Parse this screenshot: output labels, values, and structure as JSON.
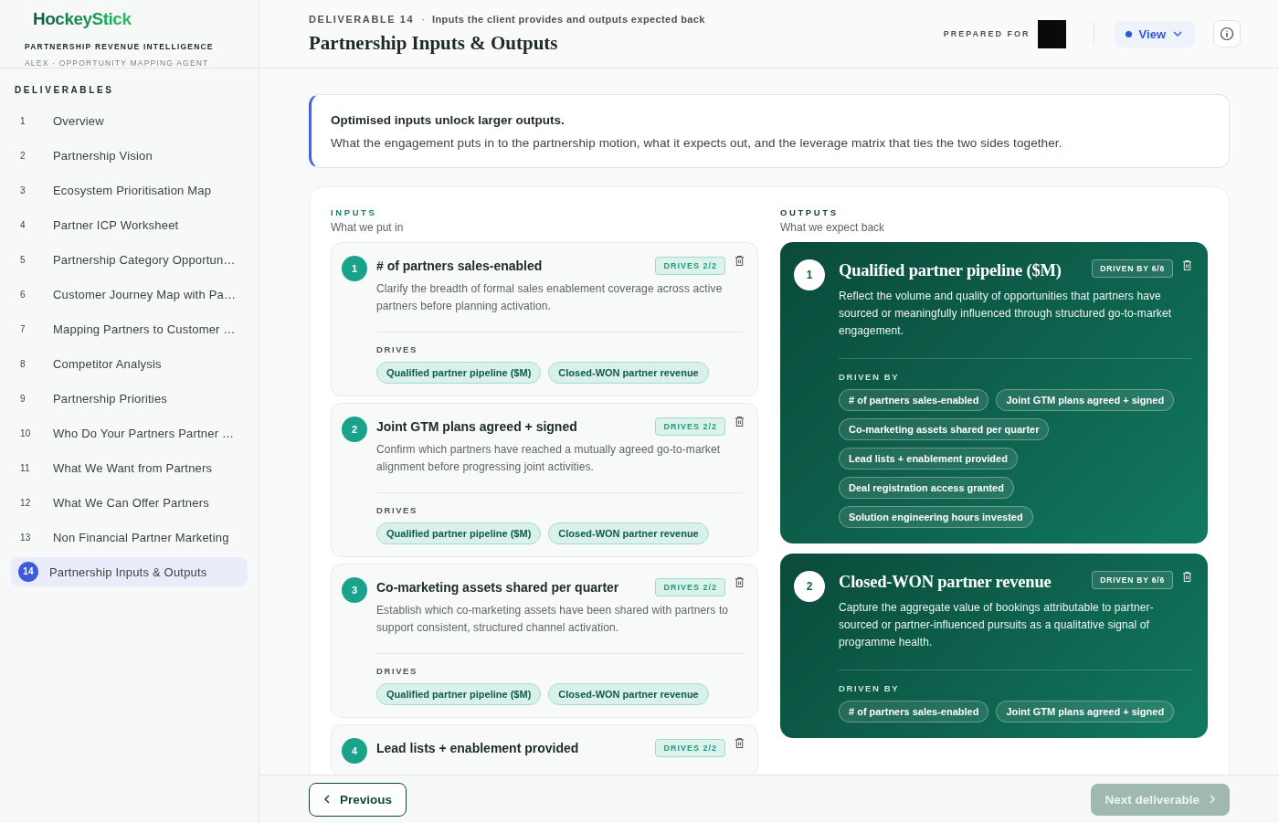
{
  "brand": {
    "logo": "HockeyStick",
    "product": "PARTNERSHIP REVENUE INTELLIGENCE",
    "agent": "ALEX · OPPORTUNITY MAPPING AGENT"
  },
  "sidebar": {
    "heading": "DELIVERABLES",
    "items": [
      {
        "number": "1",
        "label": "Overview",
        "selected": false
      },
      {
        "number": "2",
        "label": "Partnership Vision",
        "selected": false
      },
      {
        "number": "3",
        "label": "Ecosystem Prioritisation Map",
        "selected": false
      },
      {
        "number": "4",
        "label": "Partner ICP Worksheet",
        "selected": false
      },
      {
        "number": "5",
        "label": "Partnership Category Opportun…",
        "selected": false
      },
      {
        "number": "6",
        "label": "Customer Journey Map with Pa…",
        "selected": false
      },
      {
        "number": "7",
        "label": "Mapping Partners to Customer …",
        "selected": false
      },
      {
        "number": "8",
        "label": "Competitor Analysis",
        "selected": false
      },
      {
        "number": "9",
        "label": "Partnership Priorities",
        "selected": false
      },
      {
        "number": "10",
        "label": "Who Do Your Partners Partner …",
        "selected": false
      },
      {
        "number": "11",
        "label": "What We Want from Partners",
        "selected": false
      },
      {
        "number": "12",
        "label": "What We Can Offer Partners",
        "selected": false
      },
      {
        "number": "13",
        "label": "Non Financial Partner Marketing",
        "selected": false
      },
      {
        "number": "14",
        "label": "Partnership Inputs & Outputs",
        "selected": true
      }
    ]
  },
  "header": {
    "eyebrow": "DELIVERABLE 14",
    "separator": "·",
    "subtitle": "Inputs the client provides and outputs expected back",
    "title": "Partnership Inputs & Outputs",
    "prepared_for": "PREPARED FOR",
    "view_button": "View"
  },
  "callout": {
    "title": "Optimised inputs unlock larger outputs.",
    "text": "What the engagement puts in to the partnership motion, what it expects out, and the leverage matrix that ties the two sides together."
  },
  "inputs": {
    "heading": "INPUTS",
    "subheading": "What we put in",
    "cards": [
      {
        "number": "1",
        "title": "# of partners sales-enabled",
        "badge": "DRIVES 2/2",
        "description": "Clarify the breadth of formal sales enablement coverage across active partners before planning activation.",
        "links_label": "DRIVES",
        "links": [
          "Qualified partner pipeline ($M)",
          "Closed-WON partner revenue"
        ]
      },
      {
        "number": "2",
        "title": "Joint GTM plans agreed + signed",
        "badge": "DRIVES 2/2",
        "description": "Confirm which partners have reached a mutually agreed go-to-market alignment before progressing joint activities.",
        "links_label": "DRIVES",
        "links": [
          "Qualified partner pipeline ($M)",
          "Closed-WON partner revenue"
        ]
      },
      {
        "number": "3",
        "title": "Co-marketing assets shared per quarter",
        "badge": "DRIVES 2/2",
        "description": "Establish which co-marketing assets have been shared with partners to support consistent, structured channel activation.",
        "links_label": "DRIVES",
        "links": [
          "Qualified partner pipeline ($M)",
          "Closed-WON partner revenue"
        ]
      },
      {
        "number": "4",
        "title": "Lead lists + enablement provided",
        "badge": "DRIVES 2/2"
      }
    ]
  },
  "outputs": {
    "heading": "OUTPUTS",
    "subheading": "What we expect back",
    "cards": [
      {
        "number": "1",
        "title": "Qualified partner pipeline ($M)",
        "badge": "DRIVEN BY 6/6",
        "description": "Reflect the volume and quality of opportunities that partners have sourced or meaningfully influenced through structured go-to-market engagement.",
        "links_label": "DRIVEN BY",
        "links": [
          "# of partners sales-enabled",
          "Joint GTM plans agreed + signed",
          "Co-marketing assets shared per quarter",
          "Lead lists + enablement provided",
          "Deal registration access granted",
          "Solution engineering hours invested"
        ]
      },
      {
        "number": "2",
        "title": "Closed-WON partner revenue",
        "badge": "DRIVEN BY 6/6",
        "description": "Capture the aggregate value of bookings attributable to partner-sourced or partner-influenced pursuits as a qualitative signal of programme health.",
        "links_label": "DRIVEN BY",
        "links": [
          "# of partners sales-enabled",
          "Joint GTM plans agreed + signed"
        ]
      }
    ]
  },
  "footer": {
    "previous": "Previous",
    "next": "Next deliverable",
    "next_disabled": true
  }
}
